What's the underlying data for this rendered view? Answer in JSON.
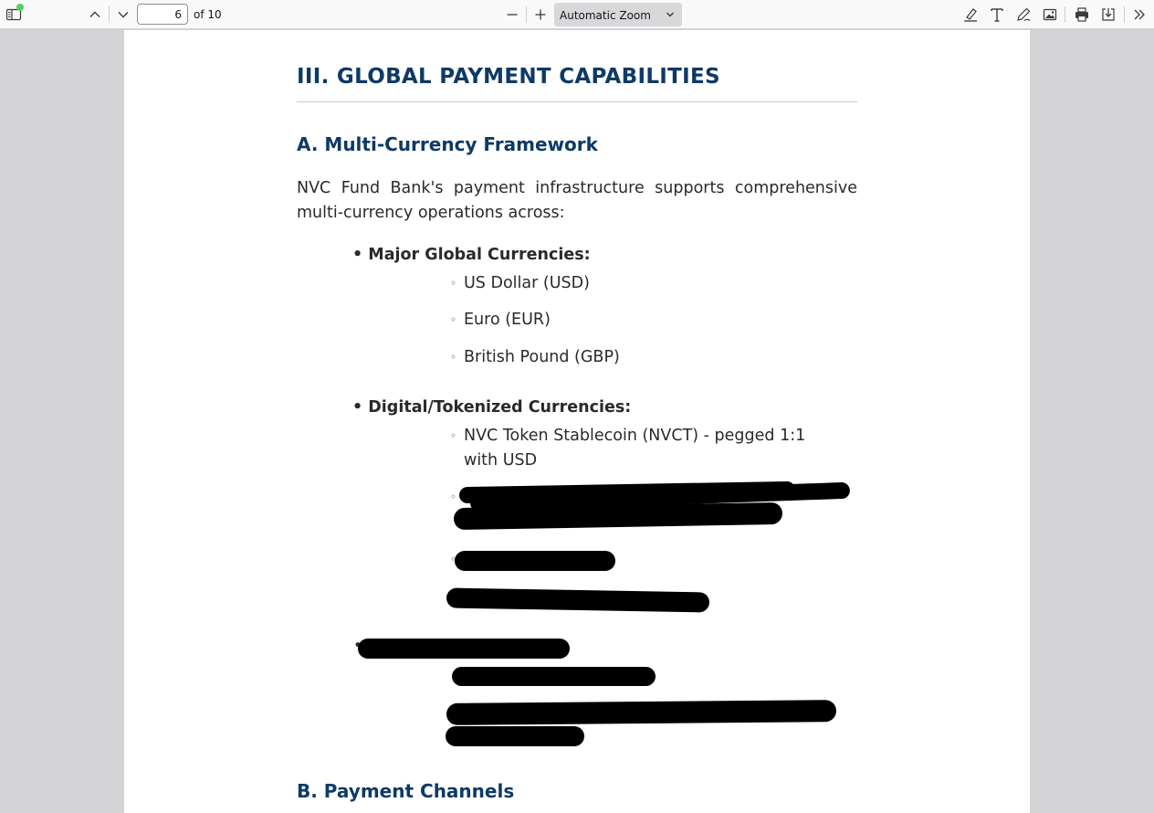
{
  "toolbar": {
    "page_number": "6",
    "page_count": "of 10",
    "zoom": "Automatic Zoom",
    "icons": [
      "sidebar-toggle-icon",
      "previous-page-icon",
      "next-page-icon",
      "zoom-out-icon",
      "zoom-in-icon",
      "highlight-icon",
      "text-icon",
      "draw-icon",
      "image-icon",
      "print-icon",
      "save-icon",
      "tools-menu-icon"
    ]
  },
  "document": {
    "section_title": "III. GLOBAL PAYMENT CAPABILITIES",
    "subsection_a": "A. Multi-Currency Framework",
    "intro": "NVC Fund Bank's payment infrastructure supports comprehensive multi-currency operations across:",
    "group1": {
      "label": "Major Global Currencies:",
      "items": [
        "US Dollar (USD)",
        "Euro (EUR)",
        "British Pound (GBP)"
      ]
    },
    "group2": {
      "label": "Digital/Tokenized Currencies:",
      "items": [
        "NVC Token Stablecoin (NVCT) - pegged 1:1 with USD"
      ]
    },
    "subsection_b": "B. Payment Channels"
  },
  "colors": {
    "heading": "#0d3a66",
    "body_text": "#2a2a2a",
    "redaction": "#000000"
  }
}
